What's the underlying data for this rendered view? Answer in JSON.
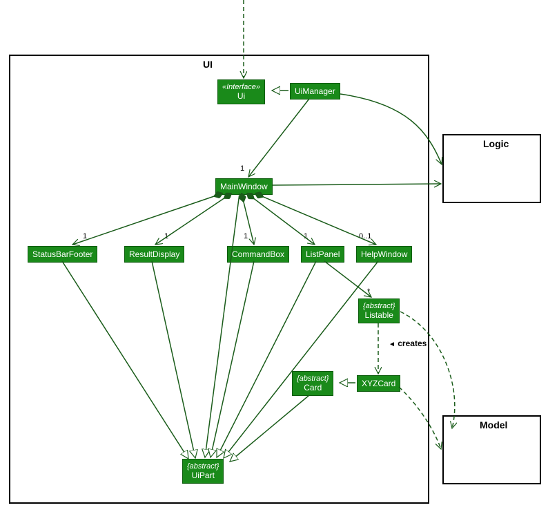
{
  "packages": {
    "ui": "UI",
    "logic": "Logic",
    "model": "Model"
  },
  "classes": {
    "ui_iface": {
      "stereo": "«Interface»",
      "name": "Ui"
    },
    "ui_manager": "UiManager",
    "main_window": "MainWindow",
    "status_bar": "StatusBarFooter",
    "result_display": "ResultDisplay",
    "command_box": "CommandBox",
    "list_panel": "ListPanel",
    "help_window": "HelpWindow",
    "listable": {
      "stereo": "{abstract}",
      "name": "Listable"
    },
    "card": {
      "stereo": "{abstract}",
      "name": "Card"
    },
    "xyz_card": "XYZCard",
    "ui_part": {
      "stereo": "{abstract}",
      "name": "UiPart"
    }
  },
  "multiplicities": {
    "main_window": "1",
    "status_bar": "1",
    "result_display": "1",
    "command_box": "1",
    "list_panel": "1",
    "help_window": "0..1",
    "listable": "*"
  },
  "labels": {
    "creates": "creates"
  }
}
